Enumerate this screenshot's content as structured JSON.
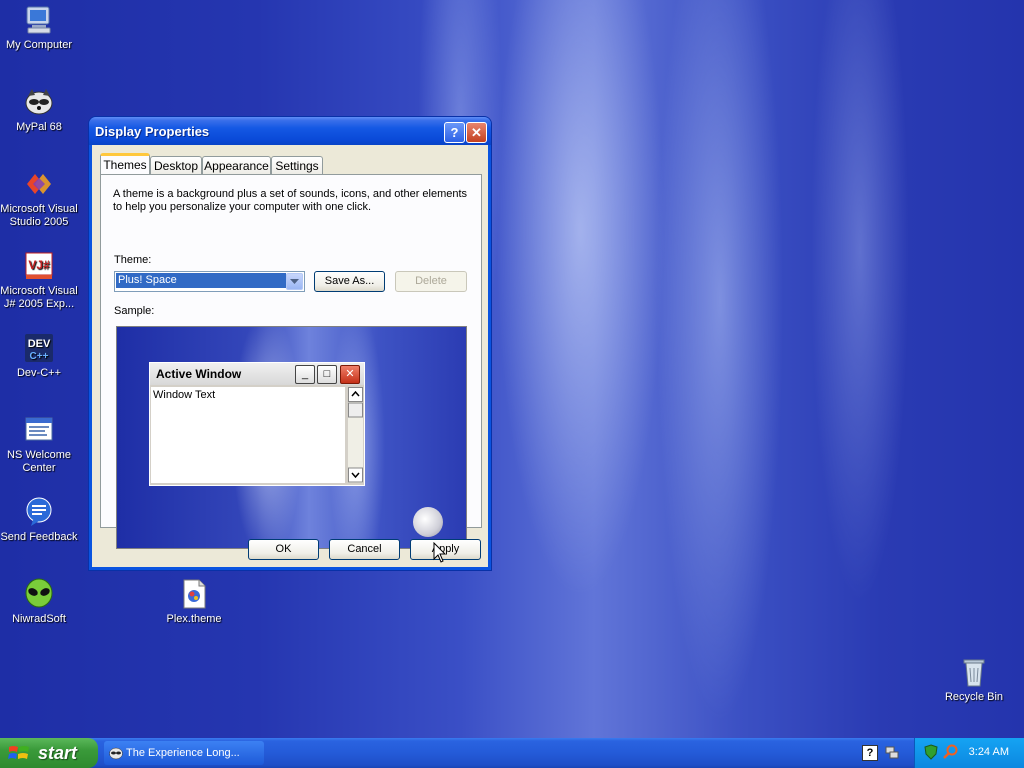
{
  "desktop": {
    "icons": [
      {
        "label": "My Computer",
        "icon": "computer-icon"
      },
      {
        "label": "MyPal 68",
        "icon": "raccoon-icon"
      },
      {
        "label": "Microsoft Visual Studio 2005",
        "icon": "visual-studio-icon"
      },
      {
        "label": "Microsoft Visual J# 2005 Exp...",
        "icon": "vj-icon"
      },
      {
        "label": "Dev-C++",
        "icon": "devcpp-icon"
      },
      {
        "label": "NS Welcome Center",
        "icon": "welcome-center-icon"
      },
      {
        "label": "Send Feedback",
        "icon": "feedback-icon"
      },
      {
        "label": "NiwradSoft",
        "icon": "alien-icon"
      },
      {
        "label": "Plex.theme",
        "icon": "theme-file-icon"
      },
      {
        "label": "Recycle Bin",
        "icon": "recycle-bin-icon"
      }
    ]
  },
  "dialog": {
    "title": "Display Properties",
    "help_glyph": "?",
    "close_glyph": "✕",
    "tabs": [
      "Themes",
      "Desktop",
      "Appearance",
      "Settings"
    ],
    "active_tab": "Themes",
    "description": "A theme is a background plus a set of sounds, icons, and other elements to help you personalize your computer with one click.",
    "theme_label": "Theme:",
    "theme_value": "Plus! Space",
    "save_as_label": "Save As...",
    "delete_label": "Delete",
    "sample_label": "Sample:",
    "sample_window": {
      "title": "Active Window",
      "text": "Window Text"
    },
    "ok_label": "OK",
    "cancel_label": "Cancel",
    "apply_label": "Apply"
  },
  "taskbar": {
    "start_label": "start",
    "task_label": "The Experience Long...",
    "clock": "3:24 AM"
  },
  "colors": {
    "accent": "#0a54e0",
    "selection": "#316ac5",
    "start_green": "#3a9a3a"
  }
}
